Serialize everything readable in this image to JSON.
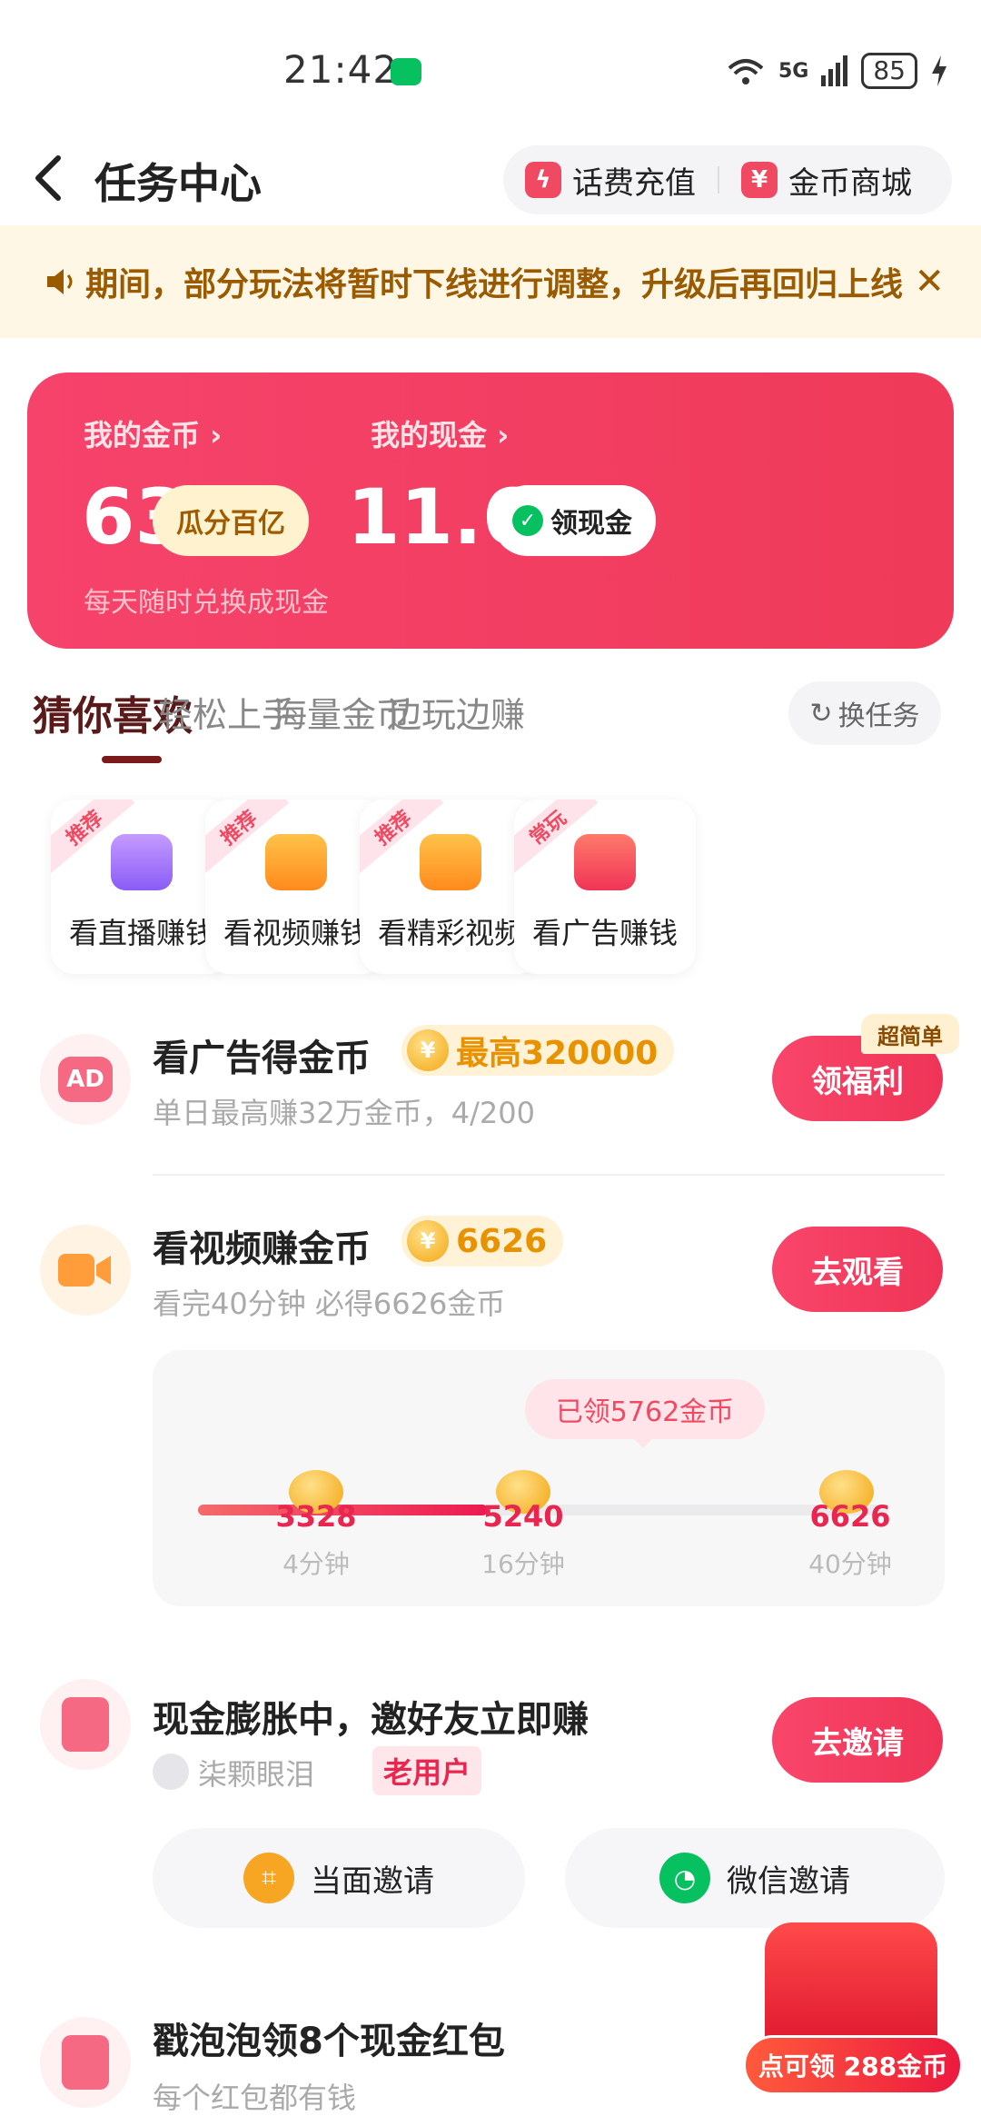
{
  "status_bar": {
    "time": "21:42",
    "network": "5G",
    "battery": "85"
  },
  "header": {
    "title": "任务中心",
    "recharge_label": "话费充值",
    "mall_label": "金币商城"
  },
  "notice": {
    "text": "期间，部分玩法将暂时下线进行调整，升级后再回归上线"
  },
  "wallet": {
    "coins_label": "我的金币 ›",
    "coins_value": "63",
    "coins_chip": "瓜分百亿",
    "coins_hint": "每天随时兑换成现金",
    "cash_label": "我的现金 ›",
    "cash_value": "11.67",
    "cash_chip": "领现金"
  },
  "tabs": {
    "items": [
      "猜你喜欢",
      "轻松上手",
      "海量金币",
      "边玩边赚"
    ],
    "swap_label": "换任务"
  },
  "tiles": [
    {
      "tag": "推荐",
      "label": "看直播赚钱",
      "icon": "live-tv-icon"
    },
    {
      "tag": "推荐",
      "label": "看视频赚钱",
      "icon": "video-camera-icon"
    },
    {
      "tag": "推荐",
      "label": "看精彩视频",
      "icon": "video-camera-icon"
    },
    {
      "tag": "常玩",
      "label": "看广告赚钱",
      "icon": "ad-tv-icon"
    }
  ],
  "tasks": {
    "ad": {
      "title": "看广告得金币",
      "badge": "最高320000",
      "sub": "单日最高赚32万金币，4/200",
      "cta": "领福利",
      "tag": "超简单"
    },
    "video": {
      "title": "看视频赚金币",
      "badge": "6626",
      "sub": "看完40分钟 必得6626金币",
      "cta": "去观看",
      "claimed": "已领5762金币",
      "progress": 0.42,
      "milestones": [
        {
          "value": "3328",
          "time": "4分钟"
        },
        {
          "value": "5240",
          "time": "16分钟"
        },
        {
          "value": "6626",
          "time": "40分钟"
        }
      ]
    },
    "invite": {
      "title": "现金膨胀中，邀好友立即赚",
      "user": "柒颗眼泪",
      "user_tag": "老用户",
      "cta": "去邀请",
      "face_label": "当面邀请",
      "wechat_label": "微信邀请"
    },
    "bubble": {
      "title": "戳泡泡领8个现金红包",
      "sub": "每个红包都有钱"
    }
  },
  "floating": {
    "label": "点可领 288金币"
  },
  "colors": {
    "brand": "#f04a63",
    "gold": "#f3a712",
    "wechat": "#07c160"
  }
}
